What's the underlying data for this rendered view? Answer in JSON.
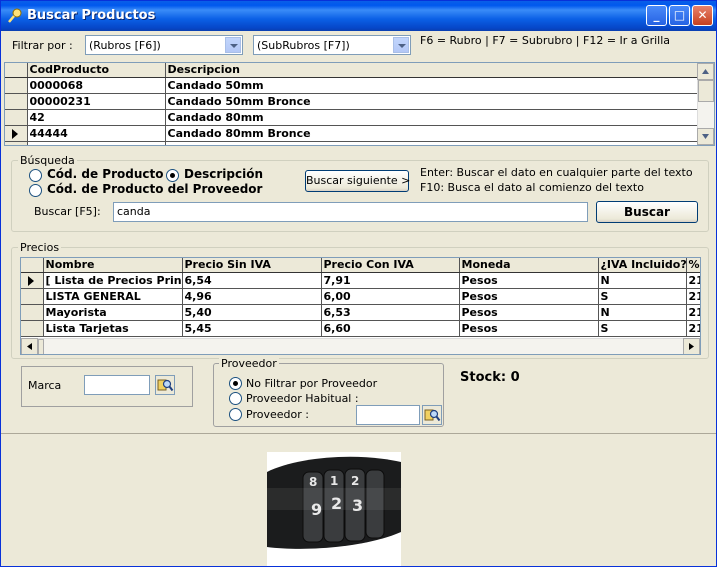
{
  "window": {
    "title": "Buscar Productos",
    "icon": "search-key-icon",
    "controls": [
      "minimize-icon",
      "maximize-icon",
      "close-icon"
    ]
  },
  "filter": {
    "label": "Filtrar por :",
    "rubro_value": "(Rubros [F6])",
    "subrubro_value": "(SubRubros [F7])",
    "hint": "F6 = Rubro | F7 = Subrubro | F12 = Ir a Grilla"
  },
  "products_grid": {
    "columns": [
      "CodProducto",
      "Descripcion"
    ],
    "rows": [
      [
        "0000068",
        "Candado 50mm"
      ],
      [
        "00000231",
        "Candado 50mm Bronce"
      ],
      [
        "42",
        "Candado 80mm"
      ],
      [
        "44444",
        "Candado 80mm Bronce"
      ],
      [
        "",
        ""
      ]
    ],
    "current_row": 3
  },
  "search": {
    "group_title": "Búsqueda",
    "opt_code": "Cód. de Producto",
    "opt_desc": "Descripción",
    "opt_supplier_code": "Cód. de Producto del Proveedor",
    "selected": "Descripción",
    "next_button": "Buscar siguiente >",
    "help_line1": "Enter: Buscar el dato en cualquier parte del texto",
    "help_line2": "F10: Busca el dato al comienzo del texto",
    "input_label": "Buscar [F5]:",
    "input_value": "canda",
    "search_button": "Buscar"
  },
  "prices": {
    "group_title": "Precios",
    "columns": [
      "Nombre",
      "Precio Sin IVA",
      "Precio Con IVA",
      "Moneda",
      "¿IVA Incluido?",
      "%"
    ],
    "rows": [
      [
        "[ Lista de Precios Princi",
        "6,54",
        "7,91",
        "Pesos",
        "N",
        "21"
      ],
      [
        "LISTA GENERAL",
        "4,96",
        "6,00",
        "Pesos",
        "S",
        "21"
      ],
      [
        "Mayorista",
        "5,40",
        "6,53",
        "Pesos",
        "N",
        "21"
      ],
      [
        "Lista Tarjetas",
        "5,45",
        "6,60",
        "Pesos",
        "S",
        "21"
      ]
    ],
    "current_row": 0
  },
  "brand": {
    "label": "Marca",
    "value": ""
  },
  "supplier": {
    "group_title": "Proveedor",
    "opt_no_filter": "No Filtrar por Proveedor",
    "opt_habitual": "Proveedor Habitual :",
    "opt_supplier": "Proveedor :",
    "selected": "No Filtrar por Proveedor",
    "value": ""
  },
  "stock": {
    "label": "Stock: 0"
  },
  "product_image": {
    "icon": "combination-lock-photo",
    "digits": [
      "8",
      "1",
      "2",
      "9",
      "2",
      "3"
    ]
  },
  "colors": {
    "titlebar": "#0058ee",
    "window_bg": "#ece9d8",
    "radio_selected": "#21a121"
  }
}
